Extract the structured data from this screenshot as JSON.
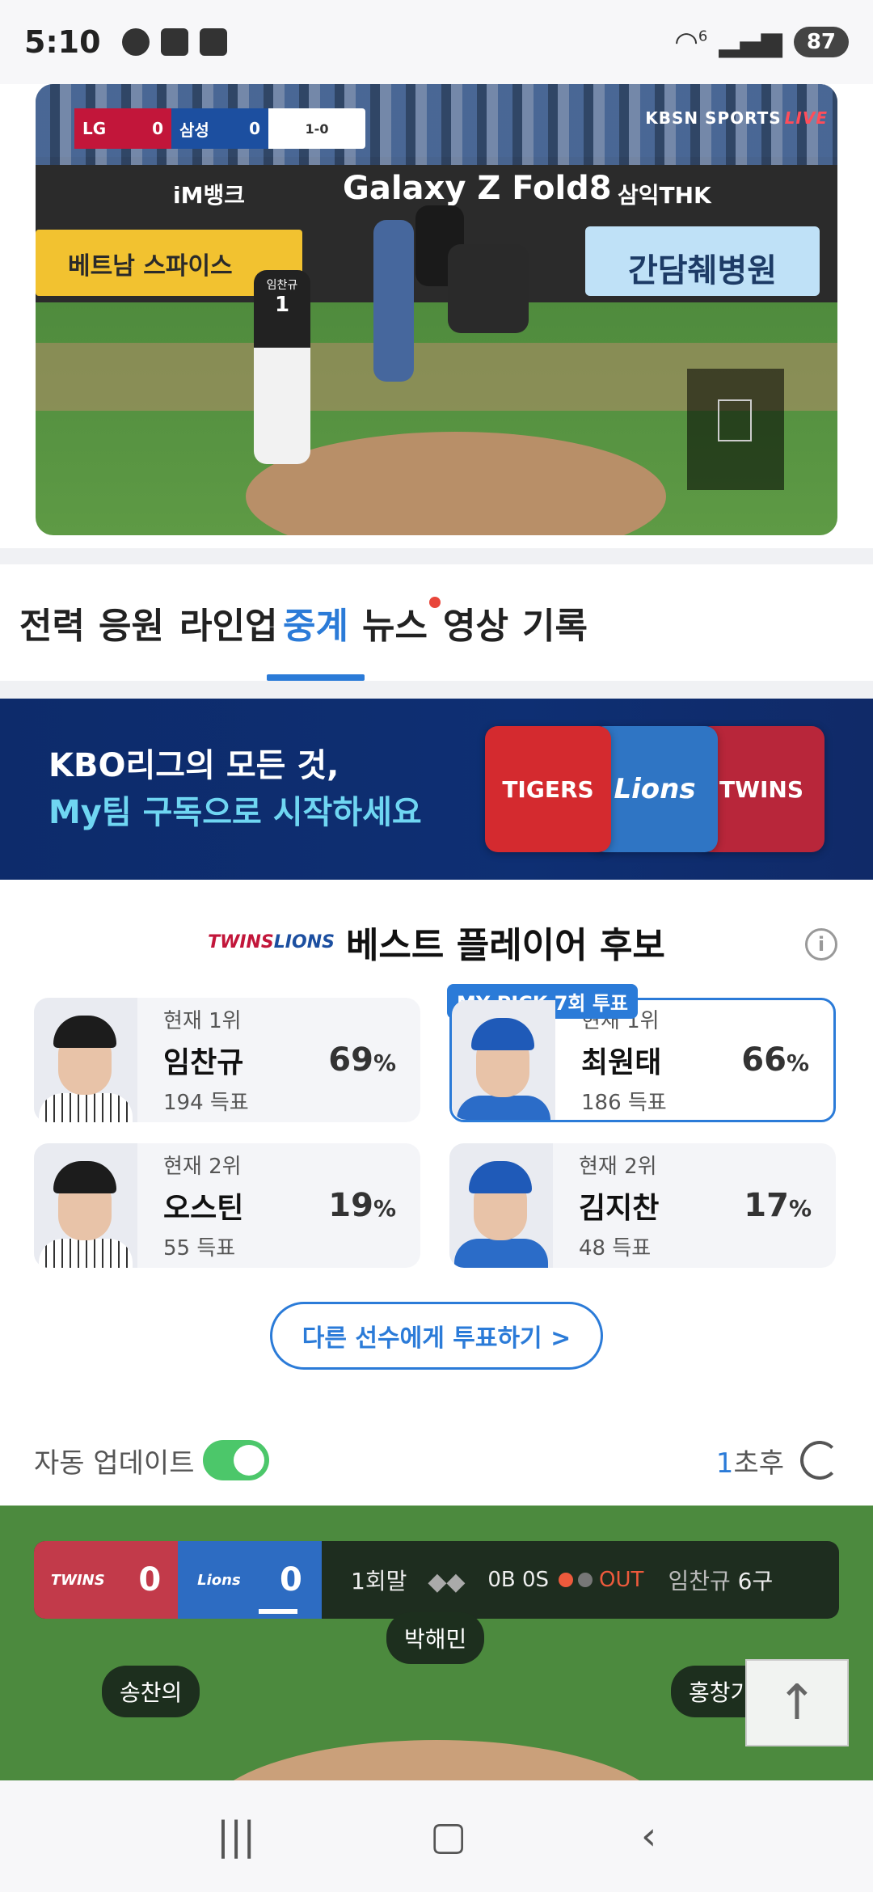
{
  "status": {
    "time": "5:10",
    "signal": "6",
    "battery": "87"
  },
  "video": {
    "scorebug": {
      "away": "LG",
      "away_score": "0",
      "home": "삼성",
      "home_score": "0",
      "count": "1-0"
    },
    "broadcaster": "KBSN SPORTS",
    "live": "LIVE",
    "wall_ads": [
      "iM뱅크",
      "Galaxy Z Fold8",
      "삼익THK"
    ],
    "ad_left": "베트남 스파이스",
    "ad_right": "간담췌병원",
    "pitcher_name_on_jersey": "임찬규",
    "pitcher_number": "1"
  },
  "tabs": [
    {
      "label": "전력"
    },
    {
      "label": "응원"
    },
    {
      "label": "라인업"
    },
    {
      "label": "중계",
      "active": true
    },
    {
      "label": "뉴스",
      "dot": true
    },
    {
      "label": "영상"
    },
    {
      "label": "기록"
    }
  ],
  "banner": {
    "line1": "KBO리그의 모든 것,",
    "line2": "My팀 구독으로 시작하세요",
    "logos": [
      "TIGERS",
      "Lions",
      "TWINS"
    ]
  },
  "best_player": {
    "title": "베스트 플레이어 후보",
    "mark_twins": "TWINS",
    "mark_lions": "LIONS",
    "info": "i",
    "candidates": [
      {
        "rank": "현재 1위",
        "name": "임찬규",
        "votes": "194 득표",
        "pct": "69",
        "team": "lg"
      },
      {
        "rank": "현재 1위",
        "name": "최원태",
        "votes": "186 득표",
        "pct": "66",
        "team": "ss",
        "my_pick": "MY PICK 7회 투표"
      },
      {
        "rank": "현재 2위",
        "name": "오스틴",
        "votes": "55 득표",
        "pct": "19",
        "team": "lg"
      },
      {
        "rank": "현재 2위",
        "name": "김지찬",
        "votes": "48 득표",
        "pct": "17",
        "team": "ss"
      }
    ],
    "pct_unit": "%",
    "vote_button": "다른 선수에게 투표하기 >"
  },
  "auto_update": {
    "label": "자동 업데이트",
    "enabled": true,
    "countdown": "1",
    "after": "초후"
  },
  "game": {
    "away_mark": "TWINS",
    "away_score": "0",
    "home_mark": "Lions",
    "home_score": "0",
    "inning": "1회말",
    "count": "0B 0S",
    "out_label": "OUT",
    "pitcher": "임찬규",
    "pitch_count": "6구",
    "fielders": [
      "송찬의",
      "박해민",
      "홍창기"
    ]
  },
  "colors": {
    "accent": "#2b7bd8",
    "lg_red": "#c2163a",
    "samsung_blue": "#1c4fa0",
    "toggle_green": "#4cc76a",
    "field_green": "#4c8a3e"
  }
}
